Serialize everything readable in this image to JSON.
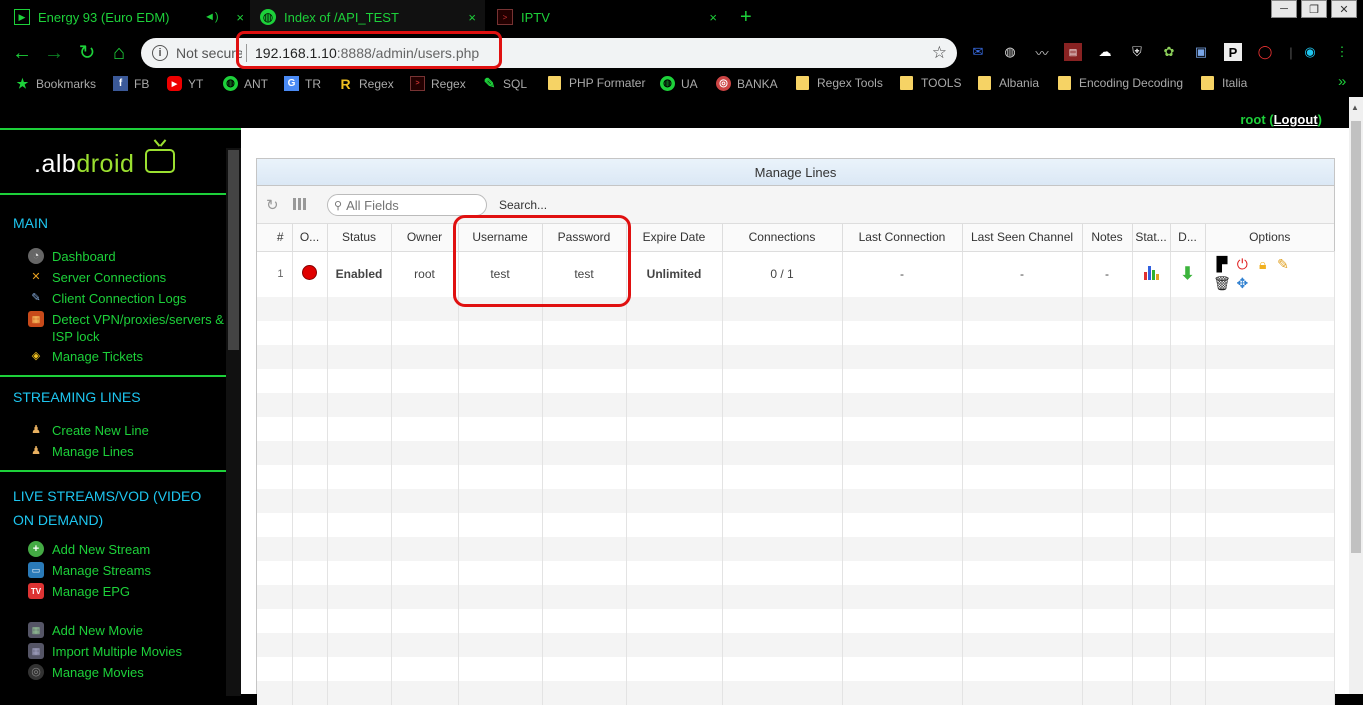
{
  "tabs": [
    {
      "title": "Energy 93 (Euro EDM)",
      "icon": "media-icon",
      "close": "×"
    },
    {
      "title": "Index of /API_TEST",
      "icon": "globe-icon",
      "close": "×"
    },
    {
      "title": "IPTV",
      "icon": "terminal-icon",
      "close": "×"
    }
  ],
  "new_tab": "+",
  "address": {
    "not_secure": "Not secure",
    "host": "192.168.1.10",
    "rest": ":8888/admin/users.php"
  },
  "bookmarks": [
    {
      "label": "Bookmarks"
    },
    {
      "label": "FB"
    },
    {
      "label": "YT"
    },
    {
      "label": "ANT"
    },
    {
      "label": "TR"
    },
    {
      "label": "Regex"
    },
    {
      "label": "Regex"
    },
    {
      "label": "SQL"
    },
    {
      "label": "PHP Formater"
    },
    {
      "label": "UA"
    },
    {
      "label": "BANKA"
    },
    {
      "label": "Regex Tools"
    },
    {
      "label": "TOOLS"
    },
    {
      "label": "Albania"
    },
    {
      "label": "Encoding Decoding"
    },
    {
      "label": "Italia"
    }
  ],
  "bookmarks_more": "»",
  "user": {
    "name": "root",
    "logout": "Logout"
  },
  "logo": {
    "prefix": ".alb",
    "suffix": "droid"
  },
  "sidebar": {
    "main": {
      "title": "MAIN",
      "items": [
        "Dashboard",
        "Server Connections",
        "Client Connection Logs",
        "Detect VPN/proxies/servers & ISP lock",
        "Manage Tickets"
      ]
    },
    "streaming": {
      "title": "STREAMING LINES",
      "items": [
        "Create New Line",
        "Manage Lines"
      ]
    },
    "live": {
      "title": "LIVE STREAMS/VOD (VIDEO ON DEMAND)",
      "items": [
        "Add New Stream",
        "Manage Streams",
        "Manage EPG",
        "Add New Movie",
        "Import Multiple Movies",
        "Manage Movies"
      ]
    }
  },
  "panel": {
    "title": "Manage Lines",
    "search_placeholder": "All Fields",
    "search_button": "Search..."
  },
  "columns": [
    "#",
    "O...",
    "Status",
    "Owner",
    "Username",
    "Password",
    "Expire Date",
    "Connections",
    "Last Connection",
    "Last Seen Channel",
    "Notes",
    "Stat...",
    "D...",
    "Options"
  ],
  "rows": [
    {
      "num": "1",
      "status": "Enabled",
      "owner": "root",
      "username": "test",
      "password": "test",
      "expire": "Unlimited",
      "connections": "0 / 1",
      "last_connection": "-",
      "last_seen": "-",
      "notes": "-"
    }
  ],
  "colors": {
    "accent": "#1dd13a",
    "section": "#1ec6f0",
    "online": "#e00000",
    "enabled": "#1a8a1a",
    "unlimited": "#f0a010",
    "highlight": "#e01010"
  }
}
